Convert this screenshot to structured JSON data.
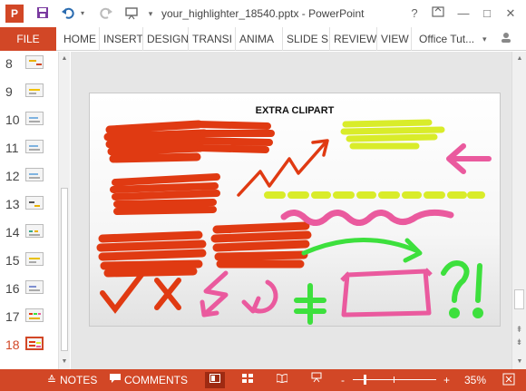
{
  "window": {
    "app_icon": "P",
    "title": "your_highlighter_18540.pptx - PowerPoint",
    "help": "?",
    "minimize": "—",
    "maximize": "□",
    "close": "✕"
  },
  "quick_access": {
    "save_icon": "save-icon",
    "undo_icon": "undo-icon",
    "redo_icon": "redo-icon",
    "start_icon": "from-beginning-icon",
    "customize_icon": "customize-icon"
  },
  "ribbon": {
    "file": "FILE",
    "tabs": [
      "HOME",
      "INSERT",
      "DESIGN",
      "TRANSI",
      "ANIMA",
      "SLIDE S",
      "REVIEW",
      "VIEW"
    ],
    "account": "Office Tut...",
    "account_caret": "▾"
  },
  "thumbnails": {
    "numbers": [
      "8",
      "9",
      "10",
      "11",
      "12",
      "13",
      "14",
      "15",
      "16",
      "17",
      "18"
    ],
    "active": "18"
  },
  "slide": {
    "title": "EXTRA CLIPART"
  },
  "status": {
    "notes": "NOTES",
    "comments": "COMMENTS",
    "zoom_minus": "-",
    "zoom_plus": "+",
    "zoom": "35%",
    "zoom_level": 0.35
  },
  "colors": {
    "accent": "#d24726",
    "highlight_red": "#e03a12",
    "highlight_yellow": "#d9ec2a",
    "highlight_pink": "#ea5a9e",
    "highlight_green": "#3de03d"
  }
}
